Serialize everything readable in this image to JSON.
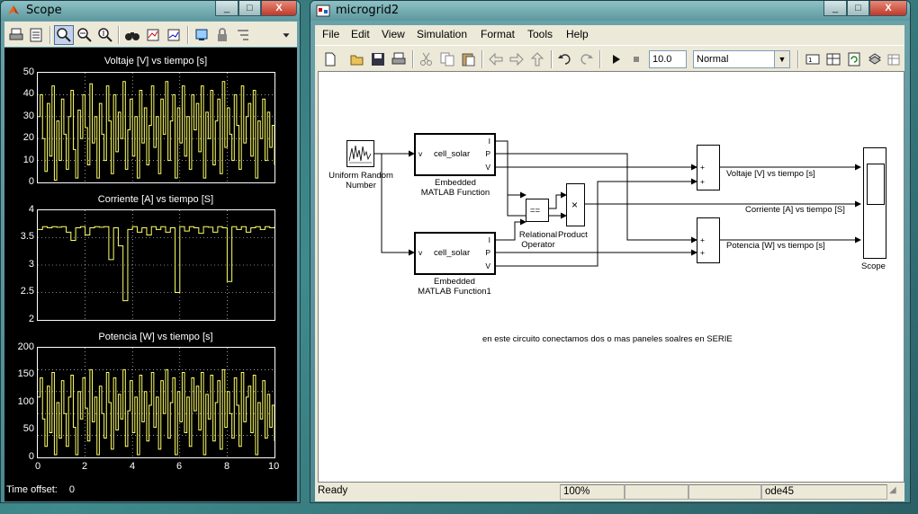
{
  "scope_window": {
    "title": "Scope",
    "controls": {
      "minimize": "_",
      "maximize": "□",
      "close": "X"
    },
    "toolbar": [
      "print-icon",
      "params-icon",
      "zoom-icon",
      "zoom-x-icon",
      "zoom-y-icon",
      "binoculars-icon",
      "save-axes-icon",
      "restore-axes-icon",
      "float-icon",
      "lock-icon",
      "select-signals-icon",
      "arrow-down-icon"
    ],
    "plots": [
      {
        "title": "Voltaje [V] vs tiempo [s]",
        "yticks": [
          "50",
          "40",
          "30",
          "20",
          "10",
          "0"
        ]
      },
      {
        "title": "Corriente [A] vs tiempo [S]",
        "yticks": [
          "4",
          "3.5",
          "3",
          "2.5",
          "2"
        ]
      },
      {
        "title": "Potencia [W] vs tiempo [s]",
        "yticks": [
          "200",
          "150",
          "100",
          "50",
          "0"
        ]
      }
    ],
    "xticks": [
      "0",
      "2",
      "4",
      "6",
      "8",
      "10"
    ],
    "time_offset_label": "Time offset:",
    "time_offset_value": "0"
  },
  "chart_data": [
    {
      "type": "line",
      "title": "Voltaje [V] vs tiempo [s]",
      "xlim": [
        0,
        10
      ],
      "ylim": [
        0,
        50
      ],
      "color": "#ffff66",
      "x": [
        0,
        0.1,
        0.2,
        0.3,
        0.4,
        0.5,
        0.6,
        0.7,
        0.8,
        0.9,
        1.0,
        1.1,
        1.2,
        1.3,
        1.4,
        1.5,
        1.6,
        1.7,
        1.8,
        1.9,
        2.0,
        2.1,
        2.2,
        2.3,
        2.4,
        2.5,
        2.6,
        2.7,
        2.8,
        2.9,
        3.0,
        3.1,
        3.2,
        3.3,
        3.4,
        3.5,
        3.6,
        3.7,
        3.8,
        3.9,
        4.0,
        4.1,
        4.2,
        4.3,
        4.4,
        4.5,
        4.6,
        4.7,
        4.8,
        4.9,
        5.0,
        5.1,
        5.2,
        5.3,
        5.4,
        5.5,
        5.6,
        5.7,
        5.8,
        5.9,
        6.0,
        6.1,
        6.2,
        6.3,
        6.4,
        6.5,
        6.6,
        6.7,
        6.8,
        6.9,
        7.0,
        7.1,
        7.2,
        7.3,
        7.4,
        7.5,
        7.6,
        7.7,
        7.8,
        7.9,
        8.0,
        8.1,
        8.2,
        8.3,
        8.4,
        8.5,
        8.6,
        8.7,
        8.8,
        8.9,
        9.0,
        9.1,
        9.2,
        9.3,
        9.4,
        9.5,
        9.6,
        9.7,
        9.8,
        9.9,
        10.0
      ],
      "y": [
        30,
        40,
        20,
        5,
        36,
        12,
        44,
        1,
        28,
        10,
        38,
        22,
        6,
        30,
        42,
        15,
        2,
        33,
        20,
        40,
        25,
        8,
        45,
        18,
        30,
        2,
        36,
        22,
        10,
        44,
        28,
        4,
        40,
        14,
        32,
        20,
        46,
        6,
        24,
        38,
        12,
        30,
        2,
        42,
        18,
        34,
        8,
        26,
        44,
        16,
        30,
        4,
        38,
        22,
        46,
        10,
        28,
        40,
        2,
        34,
        18,
        44,
        12,
        30,
        6,
        40,
        24,
        36,
        14,
        44,
        2,
        32,
        20,
        42,
        8,
        28,
        38,
        4,
        46,
        16,
        34,
        22,
        10,
        40,
        26,
        6,
        44,
        18,
        30,
        36,
        12,
        42,
        2,
        28,
        20,
        38,
        10,
        32,
        16,
        26,
        8
      ],
      "xlabel": "",
      "ylabel": ""
    },
    {
      "type": "line",
      "title": "Corriente [A] vs tiempo [S]",
      "xlim": [
        0,
        10
      ],
      "ylim": [
        2,
        4
      ],
      "color": "#ffff66",
      "x": [
        0,
        0.2,
        0.4,
        0.6,
        0.8,
        1.0,
        1.2,
        1.4,
        1.6,
        1.8,
        2.0,
        2.2,
        2.4,
        2.6,
        2.8,
        3.0,
        3.2,
        3.4,
        3.6,
        3.8,
        4.0,
        4.2,
        4.4,
        4.6,
        4.8,
        5.0,
        5.2,
        5.4,
        5.6,
        5.8,
        6.0,
        6.2,
        6.4,
        6.6,
        6.8,
        7.0,
        7.2,
        7.4,
        7.6,
        7.8,
        8.0,
        8.2,
        8.4,
        8.6,
        8.8,
        9.0,
        9.2,
        9.4,
        9.6,
        9.8,
        10.0
      ],
      "y": [
        3.65,
        3.7,
        3.68,
        3.7,
        3.69,
        3.7,
        3.6,
        3.45,
        3.68,
        3.7,
        3.55,
        3.68,
        3.7,
        3.69,
        3.7,
        3.1,
        3.68,
        3.35,
        2.35,
        3.65,
        3.7,
        3.6,
        3.68,
        3.55,
        3.7,
        3.65,
        3.7,
        3.6,
        3.68,
        2.5,
        3.7,
        3.62,
        3.7,
        3.68,
        3.58,
        3.7,
        3.69,
        3.6,
        3.7,
        3.68,
        2.7,
        3.7,
        3.65,
        3.7,
        3.6,
        3.68,
        3.7,
        3.65,
        3.7,
        3.68,
        3.7
      ],
      "xlabel": "",
      "ylabel": ""
    },
    {
      "type": "line",
      "title": "Potencia [W] vs tiempo [s]",
      "xlim": [
        0,
        10
      ],
      "ylim": [
        0,
        200
      ],
      "color": "#ffff66",
      "x": [
        0,
        0.1,
        0.2,
        0.3,
        0.4,
        0.5,
        0.6,
        0.7,
        0.8,
        0.9,
        1.0,
        1.1,
        1.2,
        1.3,
        1.4,
        1.5,
        1.6,
        1.7,
        1.8,
        1.9,
        2.0,
        2.1,
        2.2,
        2.3,
        2.4,
        2.5,
        2.6,
        2.7,
        2.8,
        2.9,
        3.0,
        3.1,
        3.2,
        3.3,
        3.4,
        3.5,
        3.6,
        3.7,
        3.8,
        3.9,
        4.0,
        4.1,
        4.2,
        4.3,
        4.4,
        4.5,
        4.6,
        4.7,
        4.8,
        4.9,
        5.0,
        5.1,
        5.2,
        5.3,
        5.4,
        5.5,
        5.6,
        5.7,
        5.8,
        5.9,
        6.0,
        6.1,
        6.2,
        6.3,
        6.4,
        6.5,
        6.6,
        6.7,
        6.8,
        6.9,
        7.0,
        7.1,
        7.2,
        7.3,
        7.4,
        7.5,
        7.6,
        7.7,
        7.8,
        7.9,
        8.0,
        8.1,
        8.2,
        8.3,
        8.4,
        8.5,
        8.6,
        8.7,
        8.8,
        8.9,
        9.0,
        9.1,
        9.2,
        9.3,
        9.4,
        9.5,
        9.6,
        9.7,
        9.8,
        9.9,
        10.0
      ],
      "y": [
        110,
        145,
        70,
        20,
        130,
        45,
        155,
        5,
        100,
        35,
        140,
        80,
        20,
        110,
        150,
        55,
        5,
        120,
        70,
        145,
        90,
        30,
        160,
        65,
        110,
        5,
        130,
        80,
        35,
        155,
        100,
        15,
        145,
        50,
        115,
        70,
        160,
        20,
        85,
        140,
        45,
        110,
        5,
        150,
        65,
        120,
        30,
        95,
        155,
        55,
        110,
        15,
        140,
        80,
        160,
        35,
        100,
        145,
        5,
        120,
        65,
        155,
        45,
        110,
        20,
        145,
        85,
        130,
        50,
        155,
        5,
        115,
        70,
        150,
        30,
        100,
        140,
        15,
        160,
        55,
        120,
        80,
        35,
        145,
        95,
        20,
        155,
        65,
        110,
        130,
        45,
        150,
        5,
        100,
        70,
        140,
        35,
        115,
        55,
        95,
        30
      ],
      "xlabel": "",
      "ylabel": ""
    }
  ],
  "model_window": {
    "title": "microgrid2",
    "controls": {
      "minimize": "_",
      "maximize": "□",
      "close": "X"
    },
    "menus": [
      "File",
      "Edit",
      "View",
      "Simulation",
      "Format",
      "Tools",
      "Help"
    ],
    "toolbar": [
      "new-icon",
      "open-icon",
      "save-icon",
      "print-icon",
      "cut-icon",
      "copy-icon",
      "paste-icon",
      "back-icon",
      "forward-icon",
      "up-icon",
      "undo-icon",
      "redo-icon",
      "play-icon",
      "stop-icon"
    ],
    "stop_time": "10.0",
    "sim_mode": "Normal",
    "toolbar_right": [
      "build-icon",
      "library-icon",
      "refresh-icon",
      "debug-icon",
      "explorer-icon"
    ],
    "blocks": {
      "uniform_random": {
        "label1": "Uniform Random",
        "label2": "Number"
      },
      "emf1": {
        "inner": "cell_solar",
        "in": "v",
        "out": [
          "I",
          "P",
          "V"
        ],
        "label1": "Embedded",
        "label2": "MATLAB Function"
      },
      "emf2": {
        "inner": "cell_solar",
        "in": "v",
        "out": [
          "I",
          "P",
          "V"
        ],
        "label1": "Embedded",
        "label2": "MATLAB Function1"
      },
      "relational": {
        "inner": "==",
        "label1": "Relational",
        "label2": "Operator"
      },
      "product": {
        "inner": "×",
        "label": "Product"
      },
      "sum1": {
        "signs": [
          "+",
          "+"
        ]
      },
      "sum2": {
        "signs": [
          "+",
          "+"
        ]
      },
      "scope": {
        "label": "Scope"
      }
    },
    "signal_labels": {
      "voltage": "Voltaje [V] vs tiempo [s]",
      "current": "Corriente [A] vs tiempo [S]",
      "power": "Potencia [W] vs tiempo [s]"
    },
    "annotation": "en este circuito conectamos dos o mas paneles soalres en SERIE",
    "status": {
      "state": "Ready",
      "zoom": "100%",
      "solver": "ode45"
    }
  }
}
